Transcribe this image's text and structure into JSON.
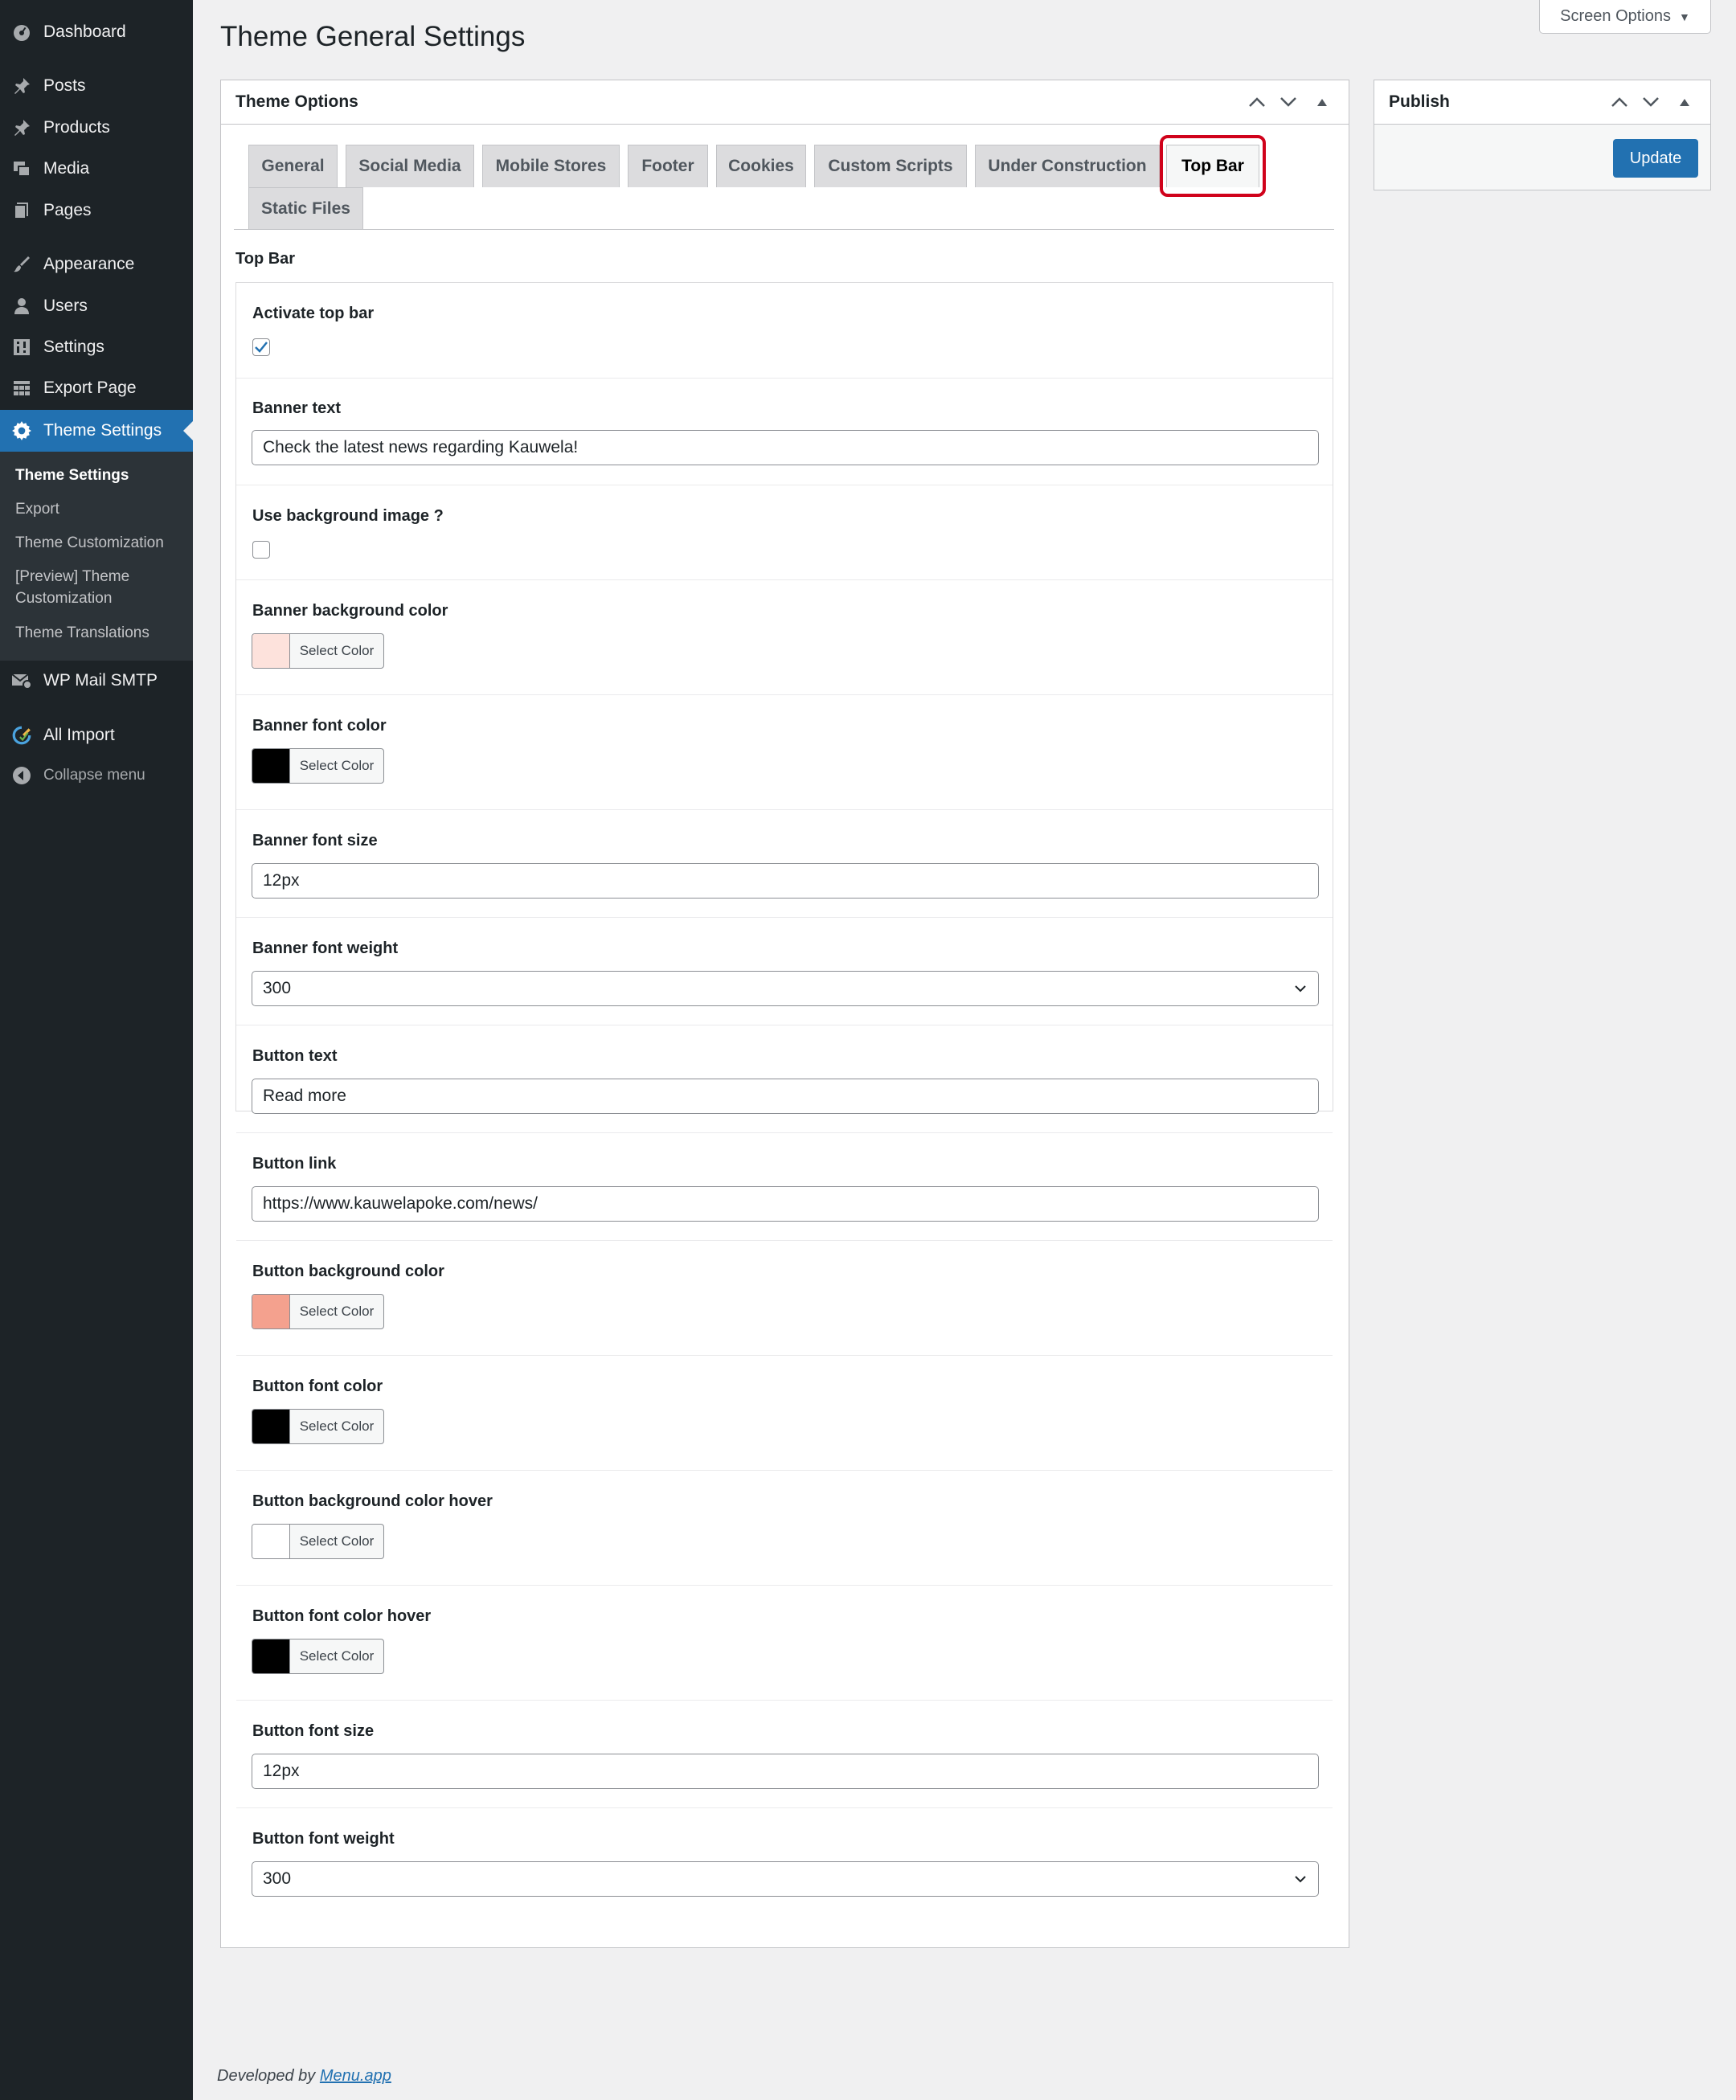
{
  "sidebar": {
    "items": [
      {
        "label": "Dashboard",
        "icon": "dashboard-icon"
      },
      {
        "label": "Posts",
        "icon": "pin-icon"
      },
      {
        "label": "Products",
        "icon": "pin-icon"
      },
      {
        "label": "Media",
        "icon": "media-icon"
      },
      {
        "label": "Pages",
        "icon": "pages-icon"
      },
      {
        "label": "Appearance",
        "icon": "brush-icon"
      },
      {
        "label": "Users",
        "icon": "user-icon"
      },
      {
        "label": "Settings",
        "icon": "settings-icon"
      },
      {
        "label": "Export Page",
        "icon": "table-icon"
      },
      {
        "label": "Theme Settings",
        "icon": "gear-icon"
      },
      {
        "label": "WP Mail SMTP",
        "icon": "mail-icon"
      },
      {
        "label": "All Import",
        "icon": "import-icon"
      },
      {
        "label": "Collapse menu",
        "icon": "collapse-icon"
      }
    ],
    "submenu": [
      "Theme Settings",
      "Export",
      "Theme Customization",
      "[Preview] Theme Customization",
      "Theme Translations"
    ]
  },
  "header": {
    "title": "Theme General Settings",
    "screen_options": "Screen Options"
  },
  "theme_options": {
    "title": "Theme Options",
    "tabs": [
      "General",
      "Social Media",
      "Mobile Stores",
      "Footer",
      "Cookies",
      "Custom Scripts",
      "Under Construction",
      "Top Bar",
      "Static Files"
    ],
    "active_tab": "Top Bar",
    "section_title": "Top Bar",
    "fields": {
      "activate_top_bar": {
        "label": "Activate top bar",
        "checked": true
      },
      "banner_text": {
        "label": "Banner text",
        "value": "Check the latest news regarding Kauwela!"
      },
      "use_bg_image": {
        "label": "Use background image ?",
        "checked": false
      },
      "banner_bg_color": {
        "label": "Banner background color",
        "color": "#fde2dc",
        "button": "Select Color"
      },
      "banner_font_color": {
        "label": "Banner font color",
        "color": "#000000",
        "button": "Select Color"
      },
      "banner_font_size": {
        "label": "Banner font size",
        "value": "12px"
      },
      "banner_font_weight": {
        "label": "Banner font weight",
        "value": "300"
      },
      "button_text": {
        "label": "Button text",
        "value": "Read more"
      },
      "button_link": {
        "label": "Button link",
        "value": "https://www.kauwelapoke.com/news/"
      },
      "button_bg_color": {
        "label": "Button background color",
        "color": "#f4a18e",
        "button": "Select Color"
      },
      "button_font_color": {
        "label": "Button font color",
        "color": "#000000",
        "button": "Select Color"
      },
      "button_bg_color_hover": {
        "label": "Button background color hover",
        "color": "#ffffff",
        "button": "Select Color"
      },
      "button_font_color_hover": {
        "label": "Button font color hover",
        "color": "#000000",
        "button": "Select Color"
      },
      "button_font_size": {
        "label": "Button font size",
        "value": "12px"
      },
      "button_font_weight": {
        "label": "Button font weight",
        "value": "300"
      }
    }
  },
  "publish": {
    "title": "Publish",
    "update_label": "Update"
  },
  "footer": {
    "prefix": "Developed by",
    "link": "Menu.app"
  }
}
